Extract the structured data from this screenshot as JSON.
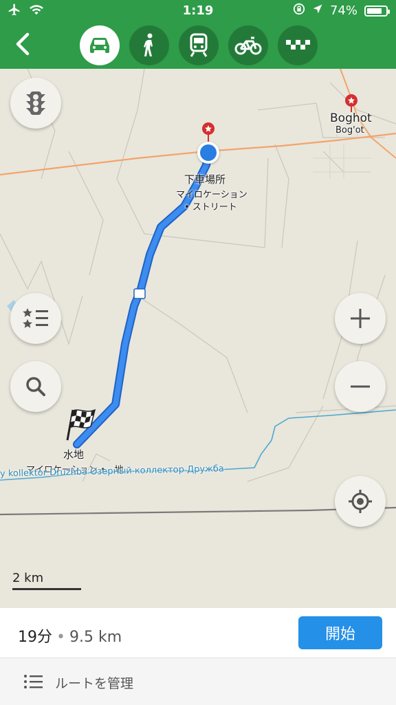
{
  "status_bar": {
    "time": "1:19",
    "battery_percent": "74%"
  },
  "toolbar": {
    "back_icon": "chevron-left-icon",
    "modes": [
      {
        "name": "car",
        "icon": "car-icon",
        "active": true
      },
      {
        "name": "walk",
        "icon": "pedestrian-icon",
        "active": false
      },
      {
        "name": "transit",
        "icon": "train-icon",
        "active": false
      },
      {
        "name": "bicycle",
        "icon": "bicycle-icon",
        "active": false
      },
      {
        "name": "taxi",
        "icon": "taxi-icon",
        "active": false
      }
    ]
  },
  "map": {
    "city_name": "Boghot",
    "city_name_alt": "Bog'ot",
    "start_label": "下車場所",
    "start_sub1": "マイロケーション",
    "start_sub2": "• ストリート",
    "end_label": "水地",
    "end_sub": "マイロケーション •　地",
    "river_label": "y kollektor Druzhba   Озерный коллектор Дружба",
    "scale_label": "2 km",
    "colors": {
      "route": "#2a7de1",
      "road": "#f2a46a",
      "river": "#4aa8d0"
    }
  },
  "route_summary": {
    "time": "19分",
    "separator": "•",
    "distance": "9.5 km",
    "start_button": "開始"
  },
  "manage_route": {
    "label": "ルートを管理"
  }
}
